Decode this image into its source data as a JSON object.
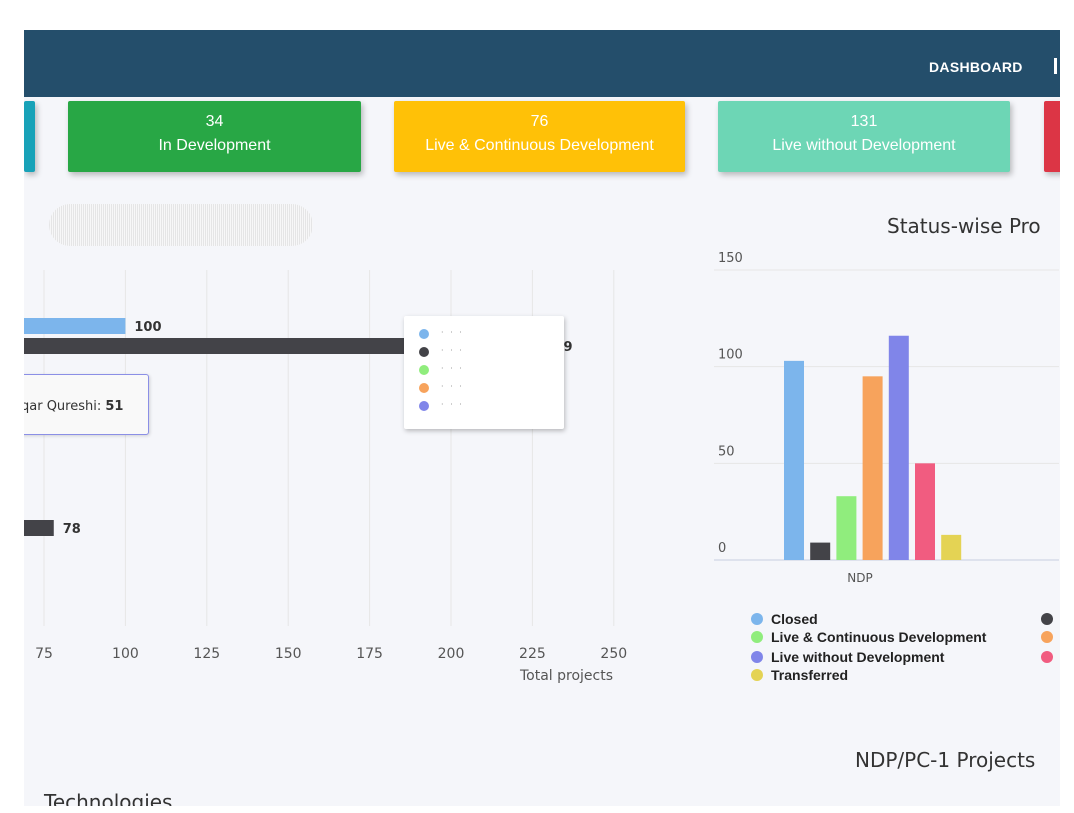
{
  "nav": {
    "links": [
      "DASHBOARD"
    ]
  },
  "cards": [
    {
      "value": "34",
      "label": "In Development",
      "color": "#28a745"
    },
    {
      "value": "76",
      "label": "Live & Continuous Development",
      "color": "#ffc107"
    },
    {
      "value": "131",
      "label": "Live without Development",
      "color": "#6dd6b5"
    }
  ],
  "left_chart": {
    "tooltip": {
      "name": "qar Qureshi",
      "value": "51"
    },
    "legend": [
      {
        "color": "#7cb5ec"
      },
      {
        "color": "#434348"
      },
      {
        "color": "#90ed7d"
      },
      {
        "color": "#f7a35c"
      },
      {
        "color": "#8085e9"
      }
    ]
  },
  "right_chart": {
    "title": "Status-wise Pro",
    "legend": [
      {
        "label": "Closed",
        "color": "#7cb5ec"
      },
      {
        "label": "Live & Continuous Development",
        "color": "#90ed7d"
      },
      {
        "label": "Live without Development",
        "color": "#8085e9"
      },
      {
        "label": "Transferred",
        "color": "#e4d354"
      },
      {
        "label": "",
        "color": "#434348"
      },
      {
        "label": "",
        "color": "#f7a35c"
      },
      {
        "label": "",
        "color": "#f15c80"
      }
    ]
  },
  "bottom": {
    "ndp_title": "NDP/PC-1 Projects",
    "tech_title": "Technologies"
  },
  "chart_data": [
    {
      "type": "bar",
      "orientation": "horizontal",
      "xlabel": "Total projects",
      "xlim": [
        50,
        275
      ],
      "xticks": [
        75,
        100,
        125,
        150,
        175,
        200,
        225,
        250
      ],
      "bars": [
        {
          "value": 100,
          "label": "100",
          "color": "#7cb5ec"
        },
        {
          "value": 229,
          "label": "29",
          "color": "#434348"
        },
        {
          "value": 78,
          "label": "78",
          "color": "#434348"
        }
      ]
    },
    {
      "type": "bar",
      "categories": [
        "NDP"
      ],
      "ylim": [
        0,
        150
      ],
      "yticks": [
        0,
        50,
        100,
        150
      ],
      "series": [
        {
          "name": "Closed",
          "values": [
            103
          ],
          "color": "#7cb5ec"
        },
        {
          "values": [
            9
          ],
          "color": "#434348"
        },
        {
          "name": "Live & Continuous Development",
          "values": [
            33
          ],
          "color": "#90ed7d"
        },
        {
          "values": [
            95
          ],
          "color": "#f7a35c"
        },
        {
          "name": "Live without Development",
          "values": [
            116
          ],
          "color": "#8085e9"
        },
        {
          "values": [
            50
          ],
          "color": "#f15c80"
        },
        {
          "name": "Transferred",
          "values": [
            13
          ],
          "color": "#e4d354"
        }
      ]
    }
  ]
}
